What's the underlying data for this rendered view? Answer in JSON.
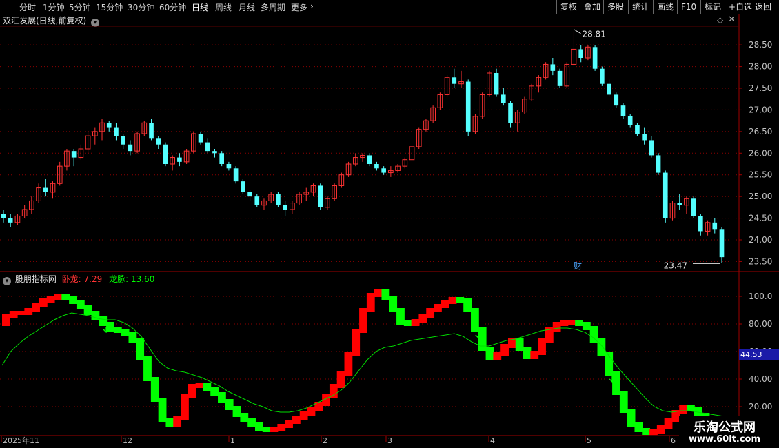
{
  "toolbar": {
    "periods": [
      {
        "label": "分时",
        "active": false
      },
      {
        "label": "1分钟",
        "active": false
      },
      {
        "label": "5分钟",
        "active": false
      },
      {
        "label": "15分钟",
        "active": false
      },
      {
        "label": "30分钟",
        "active": false
      },
      {
        "label": "60分钟",
        "active": false
      },
      {
        "label": "日线",
        "active": true
      },
      {
        "label": "周线",
        "active": false
      },
      {
        "label": "月线",
        "active": false
      },
      {
        "label": "多周期",
        "active": false
      },
      {
        "label": "更多",
        "active": false
      }
    ],
    "buttons": [
      "复权",
      "叠加",
      "多股",
      "统计",
      "画线",
      "F10",
      "标记",
      "+自选",
      "返回"
    ]
  },
  "main_chart": {
    "title": "双汇发展(日线,前复权)",
    "high_label": "28.81",
    "low_label": "23.47",
    "finance_marker": "财",
    "y_ticks": [
      "28.50",
      "28.00",
      "27.50",
      "27.00",
      "26.50",
      "26.00",
      "25.50",
      "25.00",
      "24.50",
      "24.00",
      "23.50"
    ]
  },
  "indicator": {
    "name": "股朋指标网",
    "line1_label": "卧龙:",
    "line1_value": "7.29",
    "line2_label": "龙脉:",
    "line2_value": "13.60",
    "cursor_value": "44.53",
    "y_ticks": [
      "100.0",
      "80.00",
      "60.00",
      "40.00",
      "20.00"
    ]
  },
  "x_axis": {
    "labels": [
      "2025年11",
      "12",
      "1",
      "2",
      "3",
      "4",
      "5",
      "6"
    ]
  },
  "watermark": {
    "title": "乐淘公式网",
    "url": "www.60lt.com"
  },
  "colors": {
    "up": "#ff3333",
    "down": "#54ffff",
    "line_green": "#00dd00",
    "ind_red": "#ff0000",
    "ind_green": "#00ff00",
    "grid": "#8b0000",
    "axis_text": "#c0c0c0"
  },
  "chart_data": [
    {
      "type": "candlestick",
      "title": "双汇发展(日线,前复权)",
      "ylim": [
        23.3,
        28.9
      ],
      "ohlc": [
        [
          24.6,
          24.7,
          24.4,
          24.5
        ],
        [
          24.5,
          24.6,
          24.3,
          24.4
        ],
        [
          24.4,
          24.6,
          24.35,
          24.55
        ],
        [
          24.55,
          24.8,
          24.5,
          24.7
        ],
        [
          24.7,
          25.0,
          24.6,
          24.9
        ],
        [
          24.9,
          25.3,
          24.85,
          25.2
        ],
        [
          25.2,
          25.4,
          25.0,
          25.1
        ],
        [
          25.1,
          25.35,
          24.95,
          25.3
        ],
        [
          25.3,
          25.8,
          25.25,
          25.7
        ],
        [
          25.7,
          26.1,
          25.6,
          26.05
        ],
        [
          26.05,
          26.1,
          25.7,
          25.9
        ],
        [
          25.9,
          26.2,
          25.85,
          26.1
        ],
        [
          26.1,
          26.5,
          26.0,
          26.4
        ],
        [
          26.4,
          26.6,
          26.2,
          26.5
        ],
        [
          26.5,
          26.8,
          26.3,
          26.7
        ],
        [
          26.7,
          26.75,
          26.5,
          26.6
        ],
        [
          26.6,
          26.7,
          26.3,
          26.4
        ],
        [
          26.4,
          26.45,
          26.1,
          26.2
        ],
        [
          26.2,
          26.3,
          25.95,
          26.05
        ],
        [
          26.05,
          26.5,
          26.0,
          26.45
        ],
        [
          26.45,
          26.75,
          26.4,
          26.7
        ],
        [
          26.7,
          26.8,
          26.3,
          26.35
        ],
        [
          26.35,
          26.4,
          26.1,
          26.2
        ],
        [
          26.2,
          26.25,
          25.7,
          25.75
        ],
        [
          25.75,
          25.95,
          25.6,
          25.9
        ],
        [
          25.9,
          26.0,
          25.7,
          25.8
        ],
        [
          25.8,
          26.1,
          25.75,
          26.05
        ],
        [
          26.05,
          26.5,
          26.0,
          26.45
        ],
        [
          26.45,
          26.5,
          26.2,
          26.25
        ],
        [
          26.25,
          26.35,
          26.0,
          26.05
        ],
        [
          26.05,
          26.1,
          25.9,
          26.0
        ],
        [
          26.0,
          26.05,
          25.7,
          25.75
        ],
        [
          25.75,
          25.8,
          25.6,
          25.65
        ],
        [
          25.65,
          25.7,
          25.3,
          25.35
        ],
        [
          25.35,
          25.4,
          25.05,
          25.1
        ],
        [
          25.1,
          25.15,
          24.9,
          25.0
        ],
        [
          25.0,
          25.05,
          24.75,
          24.8
        ],
        [
          24.8,
          24.95,
          24.7,
          24.9
        ],
        [
          24.9,
          25.1,
          24.85,
          25.05
        ],
        [
          25.05,
          25.1,
          24.75,
          24.8
        ],
        [
          24.8,
          24.9,
          24.55,
          24.7
        ],
        [
          24.7,
          24.9,
          24.6,
          24.85
        ],
        [
          24.85,
          25.1,
          24.8,
          25.05
        ],
        [
          25.05,
          25.2,
          24.9,
          25.1
        ],
        [
          25.1,
          25.3,
          25.0,
          25.25
        ],
        [
          25.25,
          25.3,
          24.7,
          24.75
        ],
        [
          24.75,
          25.0,
          24.7,
          24.95
        ],
        [
          24.95,
          25.3,
          24.9,
          25.25
        ],
        [
          25.25,
          25.55,
          25.2,
          25.5
        ],
        [
          25.5,
          25.8,
          25.45,
          25.75
        ],
        [
          25.75,
          26.0,
          25.7,
          25.9
        ],
        [
          25.9,
          26.0,
          25.8,
          25.95
        ],
        [
          25.95,
          26.0,
          25.7,
          25.75
        ],
        [
          25.75,
          25.8,
          25.6,
          25.65
        ],
        [
          25.65,
          25.7,
          25.5,
          25.55
        ],
        [
          25.55,
          25.7,
          25.45,
          25.6
        ],
        [
          25.6,
          25.75,
          25.55,
          25.7
        ],
        [
          25.7,
          25.9,
          25.65,
          25.85
        ],
        [
          25.85,
          26.2,
          25.8,
          26.15
        ],
        [
          26.15,
          26.6,
          26.1,
          26.55
        ],
        [
          26.55,
          26.8,
          26.5,
          26.75
        ],
        [
          26.75,
          27.1,
          26.7,
          27.05
        ],
        [
          27.05,
          27.4,
          27.0,
          27.35
        ],
        [
          27.35,
          27.8,
          27.3,
          27.75
        ],
        [
          27.75,
          27.95,
          27.5,
          27.6
        ],
        [
          27.6,
          27.9,
          27.5,
          27.65
        ],
        [
          27.65,
          27.7,
          26.4,
          26.5
        ],
        [
          26.5,
          26.9,
          26.45,
          26.85
        ],
        [
          26.85,
          27.4,
          26.8,
          27.35
        ],
        [
          27.35,
          27.9,
          27.3,
          27.85
        ],
        [
          27.85,
          27.95,
          27.3,
          27.35
        ],
        [
          27.35,
          27.5,
          27.1,
          27.15
        ],
        [
          27.15,
          27.2,
          26.6,
          26.7
        ],
        [
          26.7,
          27.0,
          26.5,
          26.95
        ],
        [
          26.95,
          27.3,
          26.9,
          27.25
        ],
        [
          27.25,
          27.6,
          27.2,
          27.55
        ],
        [
          27.55,
          27.8,
          27.4,
          27.75
        ],
        [
          27.75,
          28.1,
          27.7,
          28.05
        ],
        [
          28.05,
          28.2,
          27.8,
          27.9
        ],
        [
          27.9,
          27.95,
          27.5,
          27.55
        ],
        [
          27.55,
          28.1,
          27.5,
          28.05
        ],
        [
          28.05,
          28.81,
          28.0,
          28.4
        ],
        [
          28.4,
          28.5,
          28.1,
          28.2
        ],
        [
          28.2,
          28.5,
          28.15,
          28.45
        ],
        [
          28.45,
          28.5,
          27.9,
          27.95
        ],
        [
          27.95,
          28.0,
          27.55,
          27.6
        ],
        [
          27.6,
          27.7,
          27.3,
          27.35
        ],
        [
          27.35,
          27.4,
          27.05,
          27.1
        ],
        [
          27.1,
          27.15,
          26.8,
          26.85
        ],
        [
          26.85,
          26.9,
          26.6,
          26.65
        ],
        [
          26.65,
          26.7,
          26.4,
          26.45
        ],
        [
          26.45,
          26.6,
          26.2,
          26.3
        ],
        [
          26.3,
          26.4,
          25.9,
          25.95
        ],
        [
          25.95,
          26.0,
          25.5,
          25.55
        ],
        [
          25.55,
          25.6,
          24.4,
          24.5
        ],
        [
          24.5,
          24.9,
          24.45,
          24.85
        ],
        [
          24.85,
          25.05,
          24.7,
          24.8
        ],
        [
          24.8,
          25.0,
          24.6,
          24.95
        ],
        [
          24.95,
          25.0,
          24.5,
          24.55
        ],
        [
          24.55,
          24.6,
          24.1,
          24.2
        ],
        [
          24.2,
          24.45,
          24.1,
          24.4
        ],
        [
          24.4,
          24.5,
          24.15,
          24.25
        ],
        [
          24.25,
          24.3,
          23.47,
          23.6
        ]
      ]
    },
    {
      "type": "line",
      "title": "股朋指标网",
      "ylim": [
        0,
        110
      ],
      "series": [
        {
          "name": "卧龙",
          "values": [
            80,
            86,
            88,
            88,
            90,
            94,
            97,
            99,
            100,
            99,
            96,
            92,
            88,
            84,
            80,
            76,
            75,
            73,
            68,
            55,
            40,
            25,
            10,
            7,
            12,
            28,
            35,
            36,
            33,
            29,
            24,
            19,
            14,
            10,
            7,
            4,
            3,
            4,
            6,
            9,
            12,
            15,
            18,
            22,
            28,
            35,
            44,
            58,
            75,
            90,
            101,
            104,
            99,
            90,
            81,
            80,
            82,
            86,
            90,
            93,
            96,
            98,
            97,
            90,
            76,
            62,
            55,
            58,
            64,
            68,
            62,
            56,
            59,
            68,
            76,
            80,
            81,
            81,
            80,
            77,
            68,
            58,
            44,
            30,
            17,
            7,
            3,
            1,
            2,
            5,
            10,
            16,
            20,
            18,
            14,
            11,
            9,
            7
          ]
        },
        {
          "name": "龙脉",
          "values": [
            50,
            60,
            66,
            71,
            75,
            79,
            83,
            86,
            88,
            87,
            86,
            84,
            83,
            83,
            81,
            77,
            71,
            62,
            53,
            48,
            46,
            45,
            43,
            41,
            38,
            35,
            31,
            28,
            25,
            22,
            20,
            17,
            16,
            16,
            17,
            19,
            22,
            25,
            28,
            32,
            38,
            46,
            54,
            60,
            63,
            64,
            66,
            68,
            69,
            70,
            71,
            72,
            73,
            71,
            67,
            64,
            64,
            66,
            68,
            69,
            71,
            73,
            75,
            76,
            77,
            77,
            76,
            74,
            70,
            64,
            55,
            47,
            40,
            33,
            26,
            20,
            17,
            16,
            17,
            17,
            16,
            15,
            14,
            13
          ]
        }
      ]
    }
  ]
}
